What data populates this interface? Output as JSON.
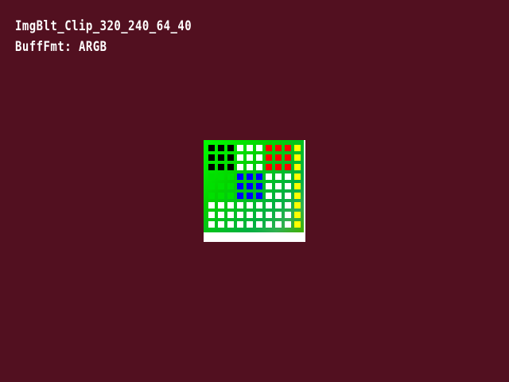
{
  "screen": {
    "background": "#521020"
  },
  "captions": {
    "line1": "ImgBlt_Clip_320_240_64_40",
    "line2": "BuffFmt: ARGB"
  },
  "image": {
    "gradient": [
      "#00ff00",
      "#04d200",
      "#00b040",
      "#30b050",
      "#40b000"
    ],
    "strip_color": "#ffffff",
    "grid": {
      "rows": 9,
      "cols": 10,
      "cell_colors": [
        [
          "k",
          "k",
          "k",
          "w",
          "w",
          "w",
          "r",
          "r",
          "r",
          "y"
        ],
        [
          "k",
          "k",
          "k",
          "w",
          "w",
          "w",
          "r",
          "r",
          "r",
          "y"
        ],
        [
          "k",
          "k",
          "k",
          "w",
          "w",
          "w",
          "r",
          "r",
          "r",
          "y"
        ],
        [
          "g",
          "g",
          "g",
          "b",
          "b",
          "b",
          "w",
          "w",
          "w",
          "y"
        ],
        [
          "g",
          "g",
          "g",
          "b",
          "b",
          "b",
          "w",
          "w",
          "w",
          "y"
        ],
        [
          "g",
          "g",
          "g",
          "b",
          "b",
          "b",
          "w",
          "w",
          "w",
          "y"
        ],
        [
          "w",
          "w",
          "w",
          "w",
          "w",
          "w",
          "w",
          "w",
          "w",
          "y"
        ],
        [
          "w",
          "w",
          "w",
          "w",
          "w",
          "w",
          "w",
          "w",
          "w",
          "y"
        ],
        [
          "w",
          "w",
          "w",
          "w",
          "w",
          "w",
          "w",
          "w",
          "w",
          "y"
        ]
      ],
      "palette": {
        "k": "#000000",
        "w": "#ffffff",
        "r": "#ff0000",
        "y": "#ffff00",
        "g": "#00e000",
        "b": "#0000ff"
      }
    }
  }
}
